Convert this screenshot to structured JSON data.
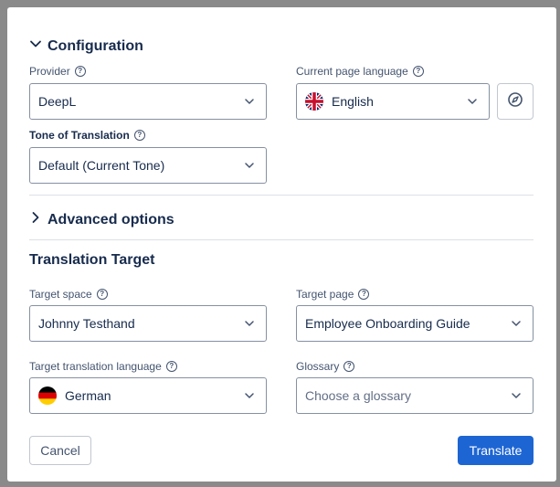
{
  "config": {
    "title": "Configuration",
    "provider": {
      "label": "Provider",
      "value": "DeepL"
    },
    "current_language": {
      "label": "Current page language",
      "value": "English"
    },
    "tone": {
      "label": "Tone of Translation",
      "value": "Default (Current Tone)"
    },
    "detect_button_icon": "compass-icon"
  },
  "advanced": {
    "title": "Advanced options"
  },
  "target": {
    "title": "Translation Target",
    "space": {
      "label": "Target space",
      "value": "Johnny Testhand"
    },
    "page": {
      "label": "Target page",
      "value": "Employee Onboarding Guide"
    },
    "language": {
      "label": "Target translation language",
      "value": "German"
    },
    "glossary": {
      "label": "Glossary",
      "placeholder": "Choose a glossary"
    }
  },
  "footer": {
    "cancel": "Cancel",
    "translate": "Translate"
  },
  "colors": {
    "primary": "#1d65d3",
    "border": "#8590a2",
    "overlay": "#8a8a8a"
  }
}
